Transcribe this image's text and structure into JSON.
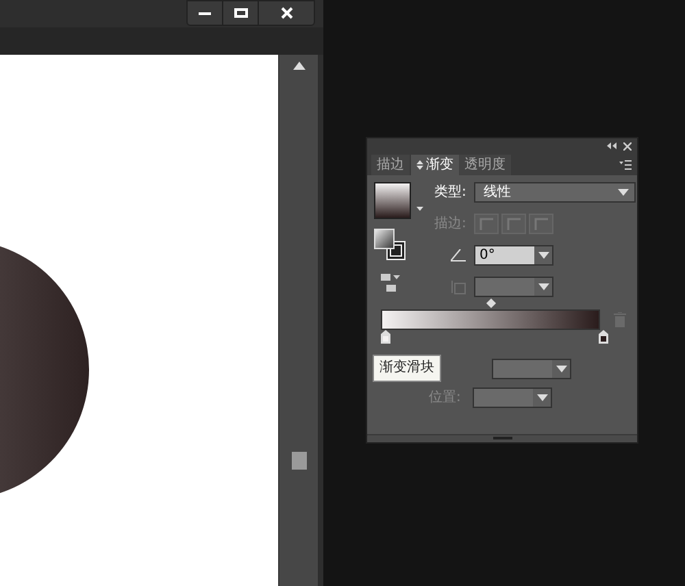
{
  "panel": {
    "tabs": [
      {
        "label": "描边",
        "selected": false
      },
      {
        "label": "渐变",
        "selected": true
      },
      {
        "label": "透明度",
        "selected": false
      }
    ],
    "type_label": "类型:",
    "type_value": "线性",
    "stroke_label": "描边:",
    "angle_value": "0°",
    "stops": [
      {
        "color": "#f4f2f2"
      },
      {
        "color": "#2a1c1c"
      }
    ],
    "tooltip": "渐变滑块",
    "location_label": "位置:"
  }
}
